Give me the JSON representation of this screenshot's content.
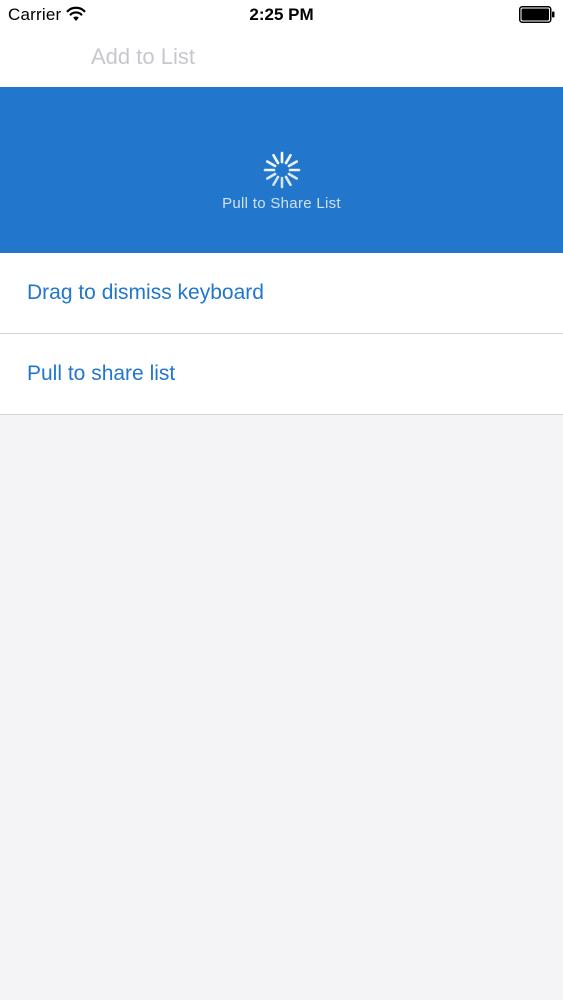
{
  "status_bar": {
    "carrier": "Carrier",
    "time": "2:25 PM",
    "icons": [
      "wifi-icon",
      "battery-icon"
    ]
  },
  "add_field": {
    "placeholder": "Add to List",
    "value": ""
  },
  "pull_banner": {
    "label": "Pull to Share List",
    "icon": "spinner-icon",
    "color": "#2276cc"
  },
  "list": {
    "items": [
      {
        "label": "Drag to dismiss keyboard"
      },
      {
        "label": "Pull to share list"
      }
    ]
  },
  "colors": {
    "accent": "#2276cc",
    "background": "#f4f4f6",
    "separator": "#d4d4d8"
  }
}
